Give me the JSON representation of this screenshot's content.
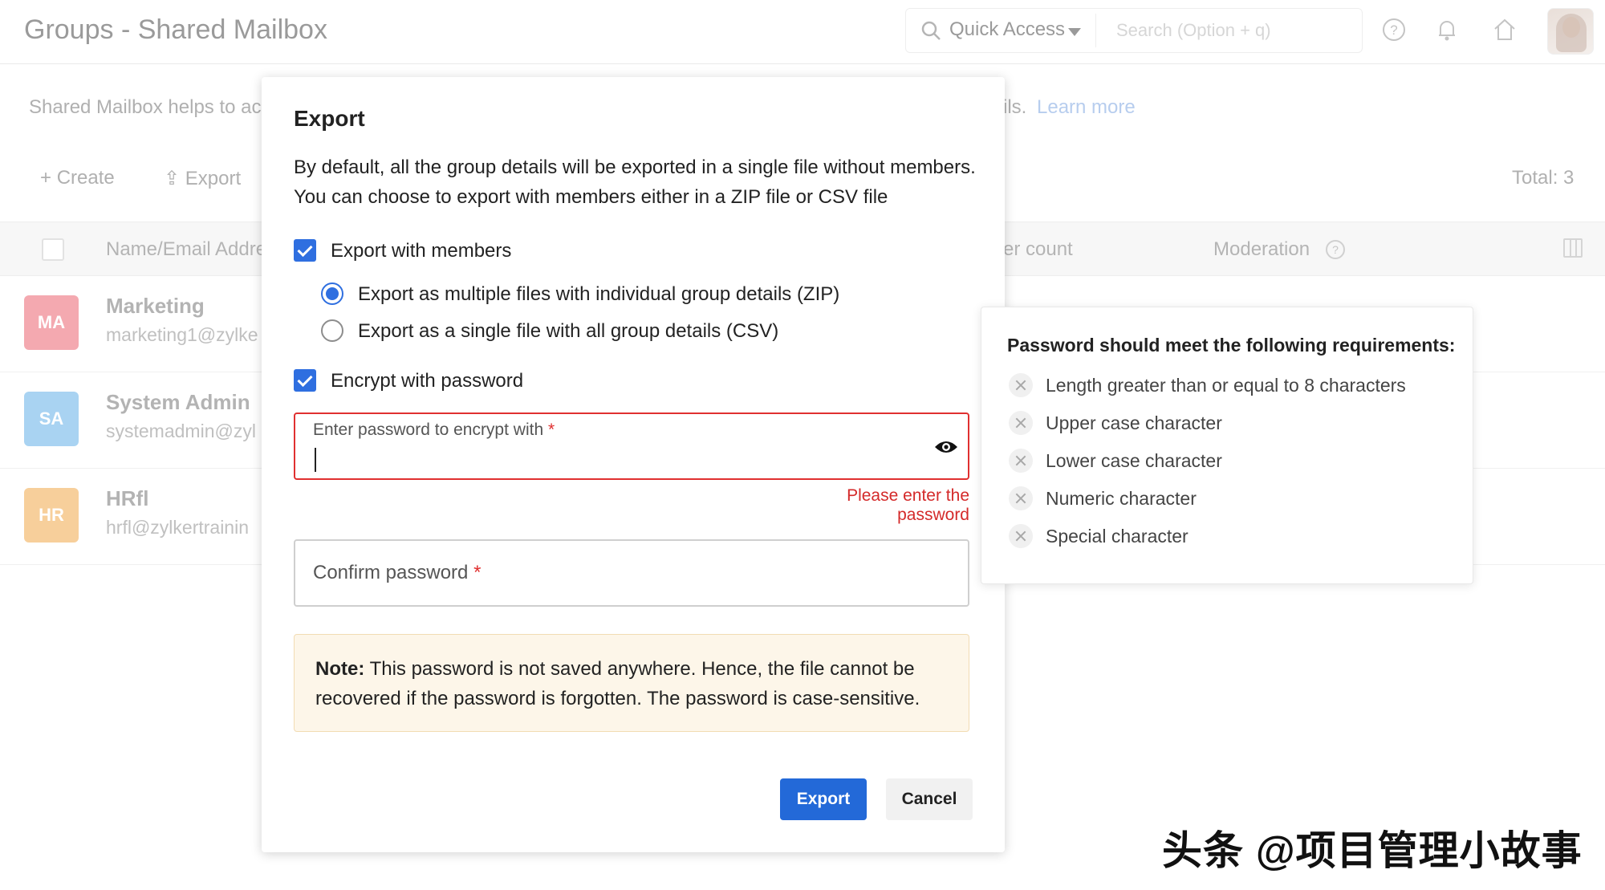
{
  "header": {
    "title": "Groups - Shared Mailbox",
    "quick_access": "Quick Access",
    "search_placeholder": "Search (Option + q)"
  },
  "page": {
    "description": "Shared Mailbox helps to acc",
    "description_tail": "ils.",
    "learn_more": "Learn more",
    "toolbar": {
      "create": "Create",
      "export": "Export"
    },
    "total": "Total: 3"
  },
  "table": {
    "headers": {
      "name": "Name/Email Addre",
      "count": "er count",
      "moderation": "Moderation"
    },
    "rows": [
      {
        "initials": "MA",
        "name": "Marketing",
        "email": "marketing1@zylke",
        "color": "#f4a9b0"
      },
      {
        "initials": "SA",
        "name": "System Admin",
        "email": "systemadmin@zyl",
        "color": "#a9d3f2"
      },
      {
        "initials": "HR",
        "name": "HRfl",
        "email": "hrfl@zylkertrainin",
        "color": "#f7cf9b"
      }
    ]
  },
  "modal": {
    "title": "Export",
    "description": "By default, all the group details will be exported in a single file without members. You can choose to export with members either in a ZIP file or CSV file",
    "export_with_members": "Export with members",
    "option_zip": "Export as multiple files with individual group details (ZIP)",
    "option_csv": "Export as a single file with all group details (CSV)",
    "encrypt_label": "Encrypt with password",
    "password_label": "Enter password to encrypt with",
    "password_error": "Please enter the password",
    "confirm_label": "Confirm password",
    "required_mark": "*",
    "note_label": "Note:",
    "note_text": " This password is not saved anywhere. Hence, the file cannot be recovered if the password is forgotten. The password is case-sensitive.",
    "export_button": "Export",
    "cancel_button": "Cancel"
  },
  "requirements": {
    "title": "Password should meet the following requirements:",
    "items": [
      "Length greater than or equal to 8 characters",
      "Upper case character",
      "Lower case character",
      "Numeric character",
      "Special character"
    ]
  },
  "watermark": "头条 @项目管理小故事",
  "colors": {
    "accent": "#2369d8",
    "error": "#d42a2a",
    "note_bg": "#fdf6e9"
  }
}
